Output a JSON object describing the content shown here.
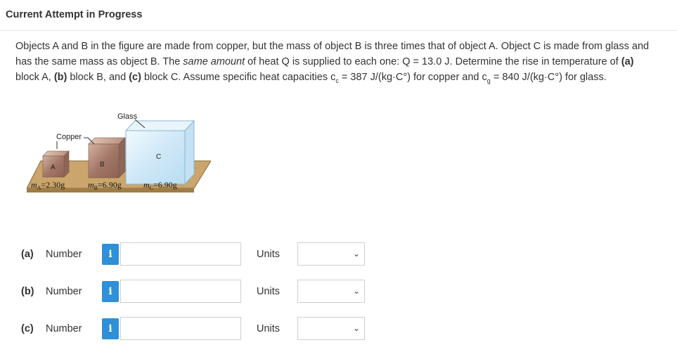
{
  "header": {
    "title": "Current Attempt in Progress"
  },
  "question": {
    "p1": "Objects A and B in the figure are made from copper, but the mass of object B is three times that of object A. Object C is made from glass and has the same mass as object B. The ",
    "p2_italic": "same amount",
    "p3": " of heat Q is supplied to each one: Q = 13.0 J. Determine the rise in temperature of ",
    "pa": "(a)",
    "p4": " block A, ",
    "pb": "(b)",
    "p5": " block B, and ",
    "pc": "(c)",
    "p6": " block C. Assume specific heat capacities c",
    "sub_c": "c",
    "p7": " = 387 J/(kg·C°) for copper and c",
    "sub_g": "g",
    "p8": " = 840 J/(kg·C°) for glass."
  },
  "figure": {
    "label_glass": "Glass",
    "label_copper": "Copper",
    "label_a": "A",
    "label_b": "B",
    "label_c": "C",
    "mass_a_sym": "m",
    "mass_a_sub": "A",
    "mass_a_val": "=2.30g",
    "mass_b_sym": "m",
    "mass_b_sub": "B",
    "mass_b_val": "=6.90g",
    "mass_c_sym": "m",
    "mass_c_sub": "C",
    "mass_c_val": "=6.90g"
  },
  "answers": [
    {
      "part": "(a)",
      "number_label": "Number",
      "info_icon": "i",
      "value": "",
      "units_label": "Units",
      "units_selected": ""
    },
    {
      "part": "(b)",
      "number_label": "Number",
      "info_icon": "i",
      "value": "",
      "units_label": "Units",
      "units_selected": ""
    },
    {
      "part": "(c)",
      "number_label": "Number",
      "info_icon": "i",
      "value": "",
      "units_label": "Units",
      "units_selected": ""
    }
  ],
  "colors": {
    "info_blue": "#2f8fd8",
    "board": "#c9a46a",
    "copper": "#b58a7a",
    "glass": "#d7ecf8"
  }
}
